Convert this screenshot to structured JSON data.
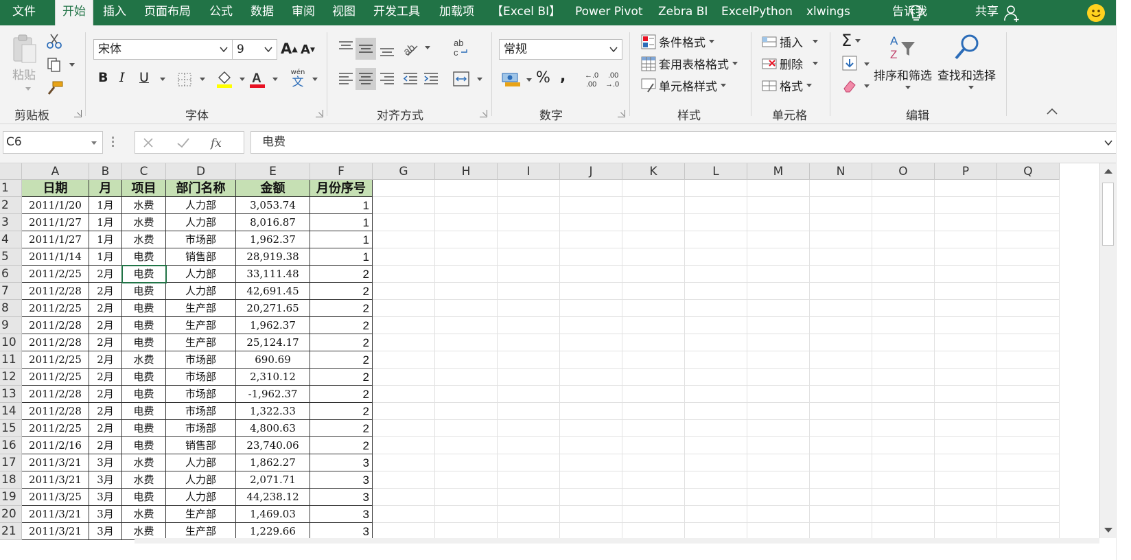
{
  "ribbon_tabs": [
    "文件",
    "开始",
    "插入",
    "页面布局",
    "公式",
    "数据",
    "审阅",
    "视图",
    "开发工具",
    "加载项",
    "【Excel BI】",
    "Power Pivot",
    "Zebra BI",
    "ExcelPython",
    "xlwings"
  ],
  "active_tab": "开始",
  "tell_me": "告诉我",
  "share": "共享",
  "clipboard": {
    "paste": "粘贴",
    "label": "剪贴板"
  },
  "font": {
    "name": "宋体",
    "size": "9",
    "label": "字体",
    "wen": "wén",
    "wen_char": "文"
  },
  "alignment": {
    "label": "对齐方式"
  },
  "number": {
    "format": "常规",
    "label": "数字"
  },
  "styles": {
    "conditional": "条件格式",
    "table": "套用表格格式",
    "cell": "单元格样式",
    "label": "样式"
  },
  "cells": {
    "insert": "插入",
    "delete": "删除",
    "format": "格式",
    "label": "单元格"
  },
  "editing": {
    "sort": "排序和筛选",
    "find": "查找和选择",
    "label": "编辑"
  },
  "formula_bar": {
    "name_box": "C6",
    "formula": "电费"
  },
  "columns": [
    "A",
    "B",
    "C",
    "D",
    "E",
    "F",
    "G",
    "H",
    "I",
    "J",
    "K",
    "L",
    "M",
    "N",
    "O",
    "P",
    "Q"
  ],
  "row_numbers": [
    "1",
    "2",
    "3",
    "4",
    "5",
    "6",
    "7",
    "8",
    "9",
    "10",
    "11",
    "12",
    "13",
    "14",
    "15",
    "16",
    "17",
    "18",
    "19",
    "20",
    "21"
  ],
  "table_headers": [
    "日期",
    "月",
    "项目",
    "部门名称",
    "金额",
    "月份序号"
  ],
  "table_rows": [
    [
      "2011/1/20",
      "1月",
      "水费",
      "人力部",
      "3,053.74",
      "1"
    ],
    [
      "2011/1/27",
      "1月",
      "水费",
      "人力部",
      "8,016.87",
      "1"
    ],
    [
      "2011/1/27",
      "1月",
      "水费",
      "市场部",
      "1,962.37",
      "1"
    ],
    [
      "2011/1/14",
      "1月",
      "电费",
      "销售部",
      "28,919.38",
      "1"
    ],
    [
      "2011/2/25",
      "2月",
      "电费",
      "人力部",
      "33,111.48",
      "2"
    ],
    [
      "2011/2/28",
      "2月",
      "电费",
      "人力部",
      "42,691.45",
      "2"
    ],
    [
      "2011/2/25",
      "2月",
      "电费",
      "生产部",
      "20,271.65",
      "2"
    ],
    [
      "2011/2/28",
      "2月",
      "电费",
      "生产部",
      "1,962.37",
      "2"
    ],
    [
      "2011/2/28",
      "2月",
      "电费",
      "生产部",
      "25,124.17",
      "2"
    ],
    [
      "2011/2/25",
      "2月",
      "水费",
      "市场部",
      "690.69",
      "2"
    ],
    [
      "2011/2/25",
      "2月",
      "电费",
      "市场部",
      "2,310.12",
      "2"
    ],
    [
      "2011/2/28",
      "2月",
      "电费",
      "市场部",
      "-1,962.37",
      "2"
    ],
    [
      "2011/2/28",
      "2月",
      "电费",
      "市场部",
      "1,322.33",
      "2"
    ],
    [
      "2011/2/25",
      "2月",
      "电费",
      "市场部",
      "4,800.63",
      "2"
    ],
    [
      "2011/2/16",
      "2月",
      "电费",
      "销售部",
      "23,740.06",
      "2"
    ],
    [
      "2011/3/21",
      "3月",
      "水费",
      "人力部",
      "1,862.27",
      "3"
    ],
    [
      "2011/3/21",
      "3月",
      "水费",
      "人力部",
      "2,071.71",
      "3"
    ],
    [
      "2011/3/25",
      "3月",
      "电费",
      "人力部",
      "44,238.12",
      "3"
    ],
    [
      "2011/3/21",
      "3月",
      "水费",
      "生产部",
      "1,469.03",
      "3"
    ],
    [
      "2011/3/21",
      "3月",
      "水费",
      "生产部",
      "1,229.66",
      "3"
    ]
  ],
  "colors": {
    "excel_green": "#217346",
    "header_fill": "#c6e0b4"
  }
}
